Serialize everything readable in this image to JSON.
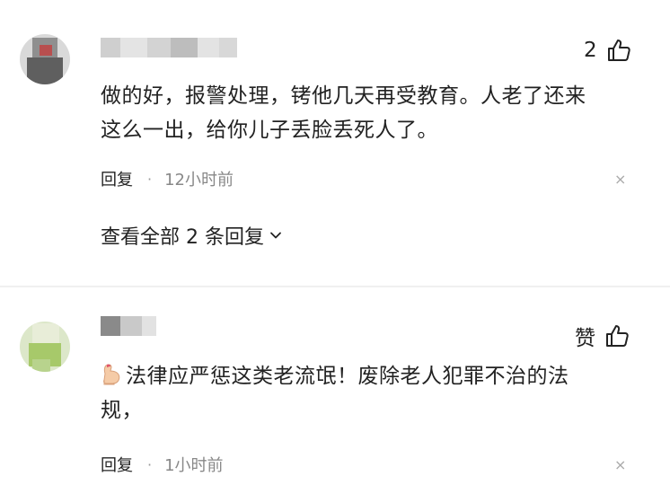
{
  "comments": [
    {
      "likes": "2",
      "text_line1": "做的好，报警处理，铐他几天再受教育。人老了还来",
      "text_line2": "这么一出，给你儿子丢脸丢死人了。",
      "reply_label": "回复",
      "dot": "·",
      "time": "12小时前",
      "close": "×",
      "view_all": "查看全部 2 条回复"
    },
    {
      "likes": "赞",
      "text_line1": "法律应严惩这类老流氓！废除老人犯罪不治的法",
      "text_line2": "规，",
      "reply_label": "回复",
      "dot": "·",
      "time": "1小时前",
      "close": "×"
    }
  ],
  "icons": {
    "like": "thumbs-up-icon",
    "expand": "chevron-down-icon",
    "emoji": "flexed-arm-emoji"
  }
}
